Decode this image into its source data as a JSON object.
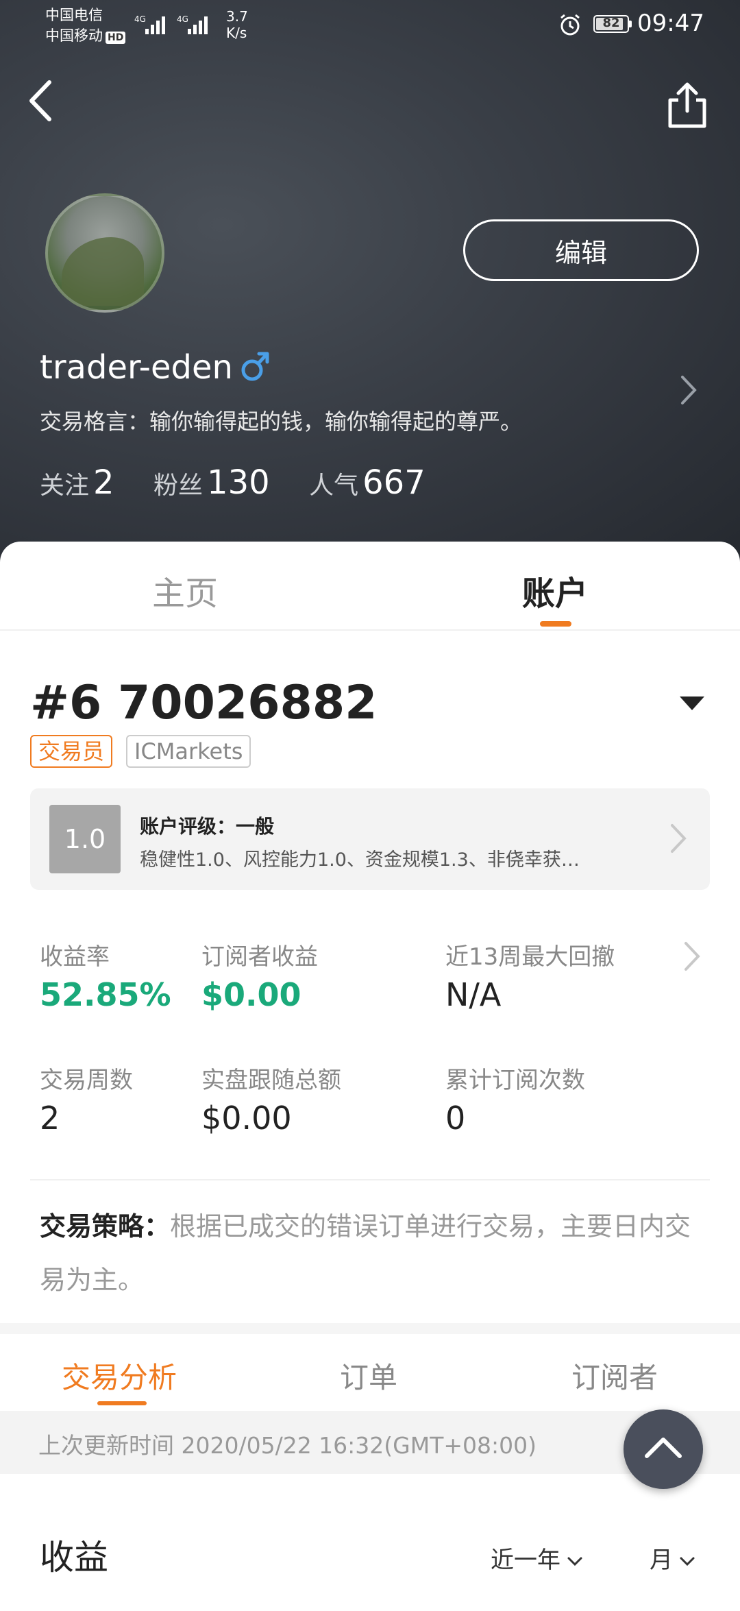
{
  "status_bar": {
    "carrier1": "中国电信",
    "carrier2": "中国移动",
    "hd": "HD",
    "net1": "4G",
    "net2": "4G",
    "speed_value": "3.7",
    "speed_unit": "K/s",
    "battery": "82",
    "time": "09:47"
  },
  "profile": {
    "edit_label": "编辑",
    "username": "trader-eden",
    "motto": "交易格言：输你输得起的钱，输你输得起的尊严。",
    "stats": [
      {
        "label": "关注",
        "value": "2"
      },
      {
        "label": "粉丝",
        "value": "130"
      },
      {
        "label": "人气",
        "value": "667"
      }
    ]
  },
  "tabs": [
    "主页",
    "账户"
  ],
  "account": {
    "id": "#6 70026882",
    "tag_role": "交易员",
    "tag_broker": "ICMarkets",
    "rating_score": "1.0",
    "rating_title": "账户评级：一般",
    "rating_desc": "稳健性1.0、风控能力1.0、资金规模1.3、非侥幸获…",
    "metrics": [
      {
        "label": "收益率",
        "value": "52.85%"
      },
      {
        "label": "订阅者收益",
        "value": "$0.00"
      },
      {
        "label": "近13周最大回撤",
        "value": "N/A"
      },
      {
        "label": "交易周数",
        "value": "2"
      },
      {
        "label": "实盘跟随总额",
        "value": "$0.00"
      },
      {
        "label": "累计订阅次数",
        "value": "0"
      }
    ],
    "strategy_label": "交易策略：",
    "strategy_text": "根据已成交的错误订单进行交易，主要日内交易为主。"
  },
  "subtabs": [
    "交易分析",
    "订单",
    "订阅者"
  ],
  "update_text": "上次更新时间 2020/05/22 16:32(GMT+08:00)",
  "section": {
    "title": "收益",
    "filter_period": "近一年",
    "filter_unit": "月"
  },
  "colors": {
    "accent": "#f07b20",
    "positive": "#1aa97a",
    "male": "#4a9fe8"
  }
}
